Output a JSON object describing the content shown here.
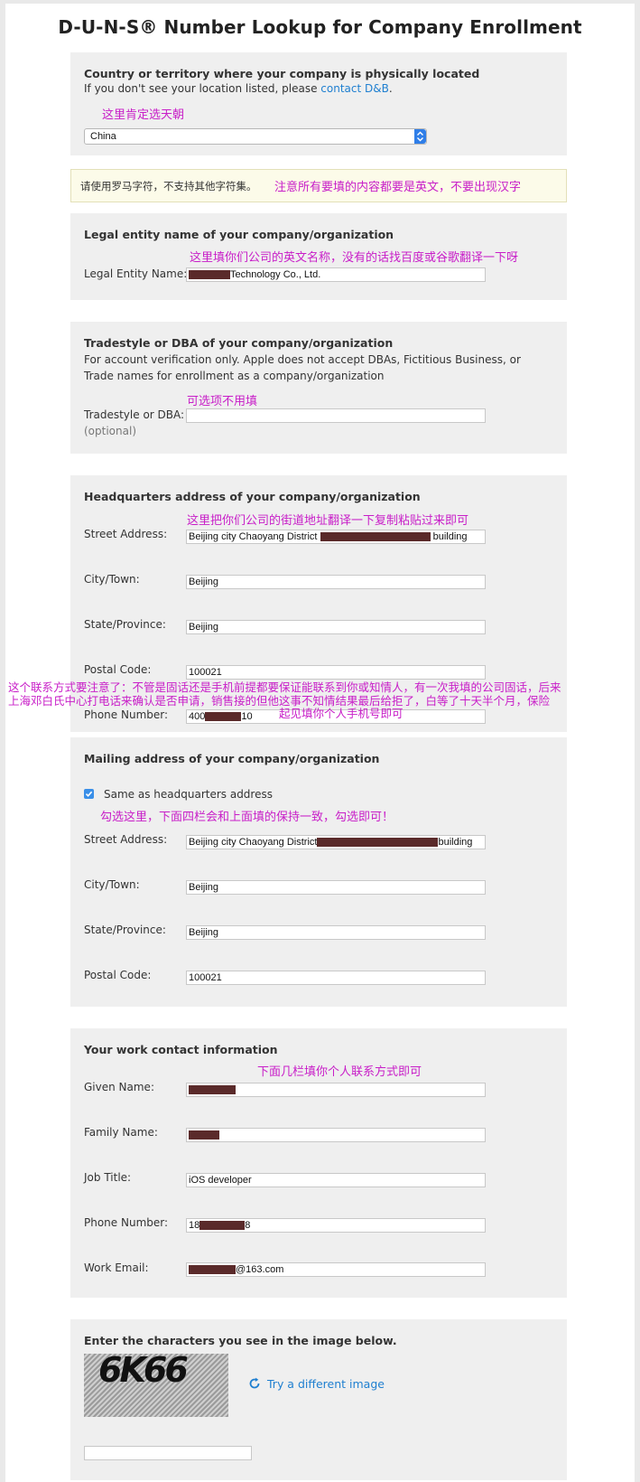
{
  "page": {
    "title": "D-U-N-S® Number Lookup for Company Enrollment"
  },
  "country_section": {
    "heading": "Country or territory where your company is physically located",
    "help_prefix": "If you don't see your location listed, please ",
    "help_link": "contact D&B",
    "help_suffix": ".",
    "selected_country": "China"
  },
  "charset_notice": {
    "text": "请使用罗马字符，不支持其他字符集。"
  },
  "legal_section": {
    "heading": "Legal entity name of your company/organization",
    "label": "Legal Entity Name:",
    "value": "Technology Co., Ltd."
  },
  "tradestyle_section": {
    "heading": "Tradestyle or DBA of your company/organization",
    "description": "For account verification only. Apple does not accept DBAs, Fictitious Business, or Trade names for enrollment as a company/organization",
    "label": "Tradestyle or DBA:",
    "optional": "(optional)",
    "value": ""
  },
  "hq_section": {
    "heading": "Headquarters address of your company/organization",
    "street_label": "Street Address:",
    "street_value": "Beijing city Chaoyang District",
    "street_suffix": "building",
    "city_label": "City/Town:",
    "city_value": "Beijing",
    "state_label": "State/Province:",
    "state_value": "Beijing",
    "postal_label": "Postal Code:",
    "postal_value": "100021",
    "phone_label": "Phone Number:",
    "phone_prefix": "400",
    "phone_suffix": "10"
  },
  "mailing_section": {
    "heading": "Mailing address of your company/organization",
    "same_as_label": "Same as headquarters address",
    "same_as_checked": true,
    "street_label": "Street Address:",
    "street_value": "Beijing city Chaoyang District",
    "street_suffix": "building",
    "city_label": "City/Town:",
    "city_value": "Beijing",
    "state_label": "State/Province:",
    "state_value": "Beijing",
    "postal_label": "Postal Code:",
    "postal_value": "100021"
  },
  "contact_section": {
    "heading": "Your work contact information",
    "given_label": "Given Name:",
    "given_value": "",
    "family_label": "Family Name:",
    "family_value": "",
    "job_label": "Job Title:",
    "job_value": "iOS developer",
    "phone_label": "Phone Number:",
    "phone_prefix": "18",
    "phone_suffix": "8",
    "email_label": "Work Email:",
    "email_suffix": "@163.com"
  },
  "captcha_section": {
    "heading": "Enter the characters you see in the image below.",
    "image_text": "6K66",
    "try_label": "Try a different image",
    "value": ""
  },
  "annotations": {
    "country": "这里肯定选天朝",
    "charset": "注意所有要填的内容都要是英文，不要出现汉字",
    "legal": "这里填你们公司的英文名称，没有的话找百度或谷歌翻译一下呀",
    "tradestyle": "可选项不用填",
    "street": "这里把你们公司的街道地址翻译一下复制粘贴过来即可",
    "phone_line1": "这个联系方式要注意了：不管是固话还是手机前提都要保证能联系到你或知情人，有一次我填的公司固话，后来",
    "phone_line2": "上海邓白氏中心打电话来确认是否申请，销售接的但他这事不知情结果最后给拒了，白等了十天半个月，保险",
    "phone_line3": "起见填你个人手机号即可",
    "mailing": "勾选这里，下面四栏会和上面填的保持一致，勾选即可！",
    "contact": "下面几栏填你个人联系方式即可"
  },
  "colors": {
    "annotation": "#c81ec8",
    "link": "#1f7fd0",
    "panel": "#efefef",
    "redaction": "#5a2a2a"
  }
}
